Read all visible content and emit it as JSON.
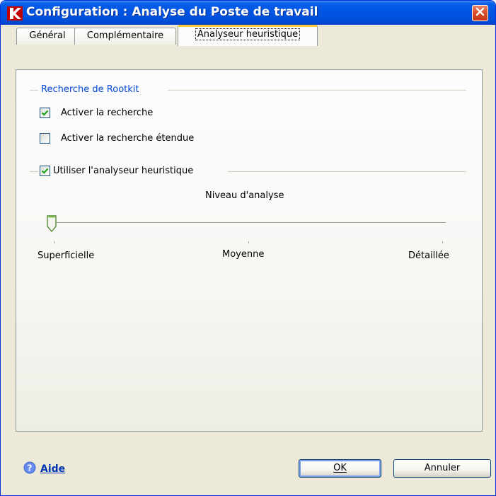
{
  "window": {
    "title": "Configuration : Analyse du Poste de travail"
  },
  "tabs": [
    {
      "label": "Général",
      "active": false
    },
    {
      "label": "Complémentaire",
      "active": false
    },
    {
      "label": "Analyseur heuristique",
      "active": true
    }
  ],
  "rootkit": {
    "group_title": "Recherche de Rootkit",
    "enable_search": {
      "label": "Activer la recherche",
      "checked": true
    },
    "enable_extended": {
      "label": "Activer la recherche étendue",
      "checked": false
    }
  },
  "heuristic": {
    "use_label": "Utiliser l'analyseur heuristique",
    "checked": true,
    "level_title": "Niveau d'analyse",
    "levels": [
      "Superficielle",
      "Moyenne",
      "Détaillée"
    ],
    "selected_level": "Superficielle"
  },
  "footer": {
    "help_label": "Aide",
    "ok_label": "OK",
    "cancel_label": "Annuler"
  },
  "colors": {
    "title_bar": "#0054e3",
    "group_title": "#0046d5",
    "link": "#0033b4",
    "active_tab_accent": "#ffc83c",
    "check_mark": "#21a121"
  },
  "icons": {
    "app": "kaspersky-k-icon",
    "close": "close-icon",
    "help": "help-question-icon"
  }
}
